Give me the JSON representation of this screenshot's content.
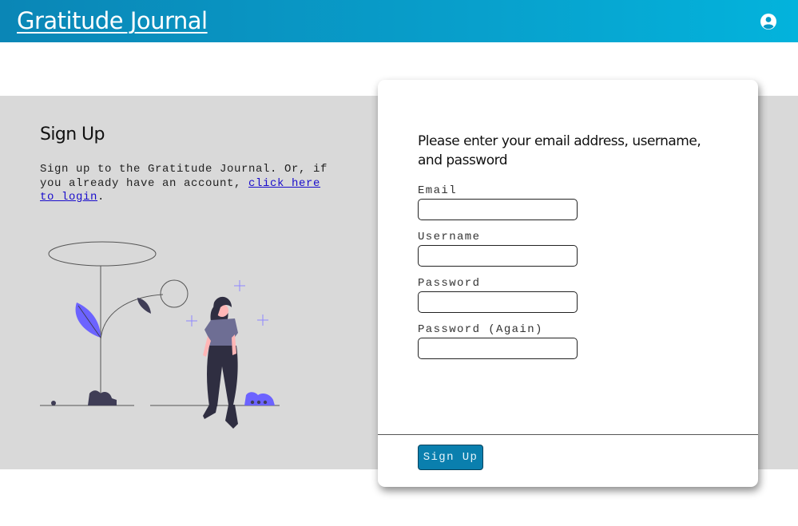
{
  "header": {
    "brand": "Gratitude Journal",
    "account_icon": "user-circle-icon"
  },
  "intro": {
    "title": "Sign Up",
    "text_before": "Sign up to the Gratitude Journal. Or, if you already have an account, ",
    "login_link": "click here to login",
    "text_after": ".",
    "illustration": "woman-standing-by-plant-illustration"
  },
  "form": {
    "heading": "Please enter your email address, username, and password",
    "fields": {
      "email": {
        "label": "Email",
        "value": ""
      },
      "username": {
        "label": "Username",
        "value": ""
      },
      "password": {
        "label": "Password",
        "value": ""
      },
      "password_again": {
        "label": "Password (Again)",
        "value": ""
      }
    },
    "submit_label": "Sign Up"
  },
  "colors": {
    "header_gradient": [
      "#0a86b6",
      "#03b3dc"
    ],
    "band": "#d9d9d9",
    "accent_purple": "#6c63ff",
    "button": "#0a7fae"
  }
}
